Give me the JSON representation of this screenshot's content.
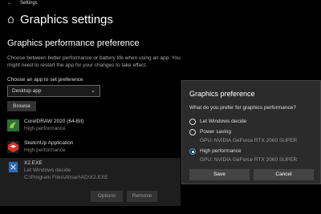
{
  "window": {
    "app_title": "Settings",
    "back_glyph": "←"
  },
  "page": {
    "title": "Graphics settings",
    "section_title": "Graphics performance preference",
    "description": "Choose between better performance or battery life when using an app. You might need to restart the app for your changes to take effect.",
    "choose_label": "Choose an app to set preference",
    "app_type_selected": "Desktop app",
    "browse_label": "Browse"
  },
  "apps": [
    {
      "name": "CorelDRAW 2020 (64-Bit)",
      "preference": "High performance",
      "icon": "coreldraw-icon"
    },
    {
      "name": "SketchUp Application",
      "preference": "High performance",
      "icon": "sketchup-icon"
    },
    {
      "name": "X2.EXE",
      "preference": "Let Windows decide",
      "path": "C:\\Program Files\\Ahsan\\AD\\X2.EXE",
      "icon": "x2-app-icon",
      "options_label": "Options",
      "remove_label": "Remove"
    }
  ],
  "dialog": {
    "title": "Graphics preference",
    "question": "What do you prefer for graphics performance?",
    "options": [
      {
        "label": "Let Windows decide",
        "gpu": "",
        "selected": false
      },
      {
        "label": "Power saving",
        "gpu": "GPU: NVIDIA GeForce RTX 2060 SUPER",
        "selected": false
      },
      {
        "label": "High performance",
        "gpu": "GPU: NVIDIA GeForce RTX 2060 SUPER",
        "selected": true
      }
    ],
    "save_label": "Save",
    "cancel_label": "Cancel"
  },
  "colors": {
    "accent": "#3a96dd",
    "background": "#000000",
    "dialog_bg": "#2b2b2b"
  }
}
